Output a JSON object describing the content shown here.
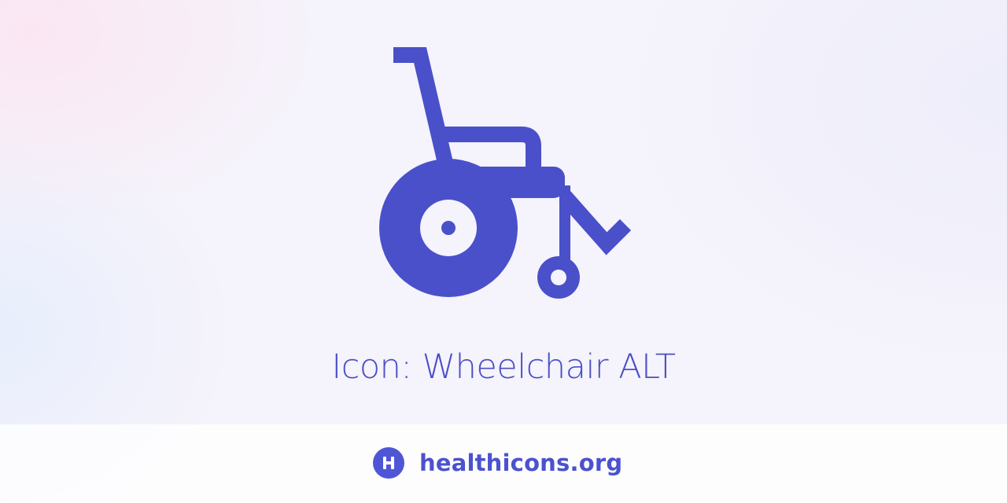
{
  "hero": {
    "icon": "wheelchair-alt-icon",
    "icon_color": "#4a50c9"
  },
  "page": {
    "title": "Icon: Wheelchair ALT"
  },
  "footer": {
    "logo_icon": "healthicons-logo-icon",
    "logo_color": "#4f56d6",
    "site_name": "healthicons.org"
  }
}
